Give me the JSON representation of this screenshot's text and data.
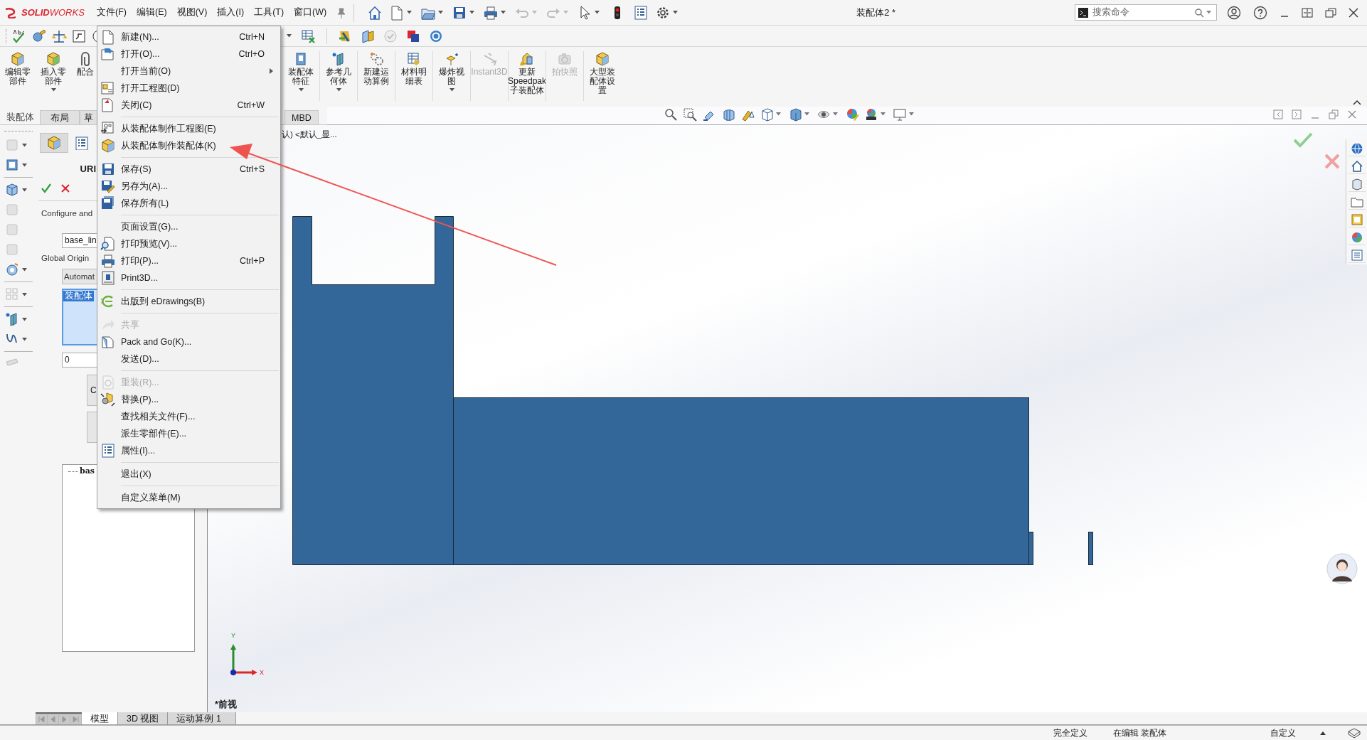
{
  "logo": {
    "brand": "**SOLID**WORKS"
  },
  "menu_bar": [
    "文件(F)",
    "编辑(E)",
    "视图(V)",
    "插入(I)",
    "工具(T)",
    "窗口(W)"
  ],
  "document_title": "装配体2 *",
  "search": {
    "placeholder": "搜索命令"
  },
  "command_manager": {
    "groups": [
      [
        {
          "label": "编辑零部件",
          "dropdown": false,
          "disabled": false
        },
        {
          "label": "插入零部件",
          "dropdown": true,
          "disabled": false
        },
        {
          "label": "配合",
          "dropdown": false,
          "disabled": false
        }
      ],
      [
        {
          "label": "装配体特征",
          "dropdown": true,
          "disabled": false
        },
        {
          "label": "参考几何体",
          "dropdown": true,
          "disabled": false
        },
        {
          "label": "新建运动算例",
          "dropdown": false,
          "disabled": false
        },
        {
          "label": "材料明细表",
          "dropdown": false,
          "disabled": false
        },
        {
          "label": "爆炸视图",
          "dropdown": true,
          "disabled": false
        },
        {
          "label": "Instant3D",
          "dropdown": false,
          "disabled": true
        },
        {
          "label": "更新Speedpak子装配体",
          "dropdown": false,
          "disabled": false
        },
        {
          "label": "拍快照",
          "dropdown": false,
          "disabled": true
        },
        {
          "label": "大型装配体设置",
          "dropdown": false,
          "disabled": false
        }
      ]
    ]
  },
  "command_tabs": [
    {
      "label": "装配体",
      "selected": true
    },
    {
      "label": "布局",
      "selected": false
    },
    {
      "label": "草",
      "selected": false
    },
    {
      "label": "MBD",
      "selected": false
    }
  ],
  "property_manager": {
    "title": "URI",
    "section_label": "Configure and",
    "name_field": {
      "value": "base_lin"
    },
    "origin_label": "Global Origin",
    "origin_dropdown": {
      "value": "Automat"
    },
    "list": [
      {
        "label": "装配体",
        "selected": true
      }
    ],
    "number_field": {
      "value": "0"
    },
    "button_label": "C",
    "tree": [
      {
        "label": "bas"
      }
    ]
  },
  "breadcrumb": "认) <默认_显...",
  "view_label": "*前视",
  "triad": {
    "x": "X",
    "y": "Y"
  },
  "file_menu": {
    "sections": [
      [
        {
          "label": "新建(N)...",
          "shortcut": "Ctrl+N",
          "disabled": false,
          "submenu": false
        },
        {
          "label": "打开(O)...",
          "shortcut": "Ctrl+O",
          "disabled": false,
          "submenu": false
        },
        {
          "label": "打开当前(O)",
          "disabled": false,
          "submenu": true
        },
        {
          "label": "打开工程图(D)",
          "disabled": false,
          "submenu": false
        },
        {
          "label": "关闭(C)",
          "shortcut": "Ctrl+W",
          "disabled": false,
          "submenu": false
        }
      ],
      [
        {
          "label": "从装配体制作工程图(E)",
          "disabled": false,
          "submenu": false
        },
        {
          "label": "从装配体制作装配体(K)",
          "disabled": false,
          "submenu": false
        }
      ],
      [
        {
          "label": "保存(S)",
          "shortcut": "Ctrl+S",
          "disabled": false,
          "submenu": false
        },
        {
          "label": "另存为(A)...",
          "disabled": false,
          "submenu": false
        },
        {
          "label": "保存所有(L)",
          "disabled": false,
          "submenu": false
        }
      ],
      [
        {
          "label": "页面设置(G)...",
          "disabled": false,
          "submenu": false
        },
        {
          "label": "打印预览(V)...",
          "disabled": false,
          "submenu": false
        },
        {
          "label": "打印(P)...",
          "shortcut": "Ctrl+P",
          "disabled": false,
          "submenu": false
        },
        {
          "label": "Print3D...",
          "disabled": false,
          "submenu": false
        }
      ],
      [
        {
          "label": "出版到 eDrawings(B)",
          "disabled": false,
          "submenu": false
        }
      ],
      [
        {
          "label": "共享",
          "disabled": true,
          "submenu": false
        },
        {
          "label": "Pack and Go(K)...",
          "disabled": false,
          "submenu": false
        },
        {
          "label": "发送(D)...",
          "disabled": false,
          "submenu": false
        }
      ],
      [
        {
          "label": "重装(R)...",
          "disabled": true,
          "submenu": false
        },
        {
          "label": "替换(P)...",
          "disabled": false,
          "submenu": false
        },
        {
          "label": "查找相关文件(F)...",
          "disabled": false,
          "submenu": false
        },
        {
          "label": "派生零部件(E)...",
          "disabled": false,
          "submenu": false
        },
        {
          "label": "属性(I)...",
          "disabled": false,
          "submenu": false
        }
      ],
      [
        {
          "label": "退出(X)",
          "disabled": false,
          "submenu": false
        }
      ],
      [
        {
          "label": "自定义菜单(M)",
          "disabled": false,
          "submenu": false
        }
      ]
    ]
  },
  "bottom_tabs": [
    {
      "label": "模型",
      "selected": true
    },
    {
      "label": "3D 视图",
      "selected": false
    },
    {
      "label": "运动算例 1",
      "selected": false
    }
  ],
  "status_bar": [
    "完全定义",
    "在编辑 装配体",
    "自定义"
  ]
}
